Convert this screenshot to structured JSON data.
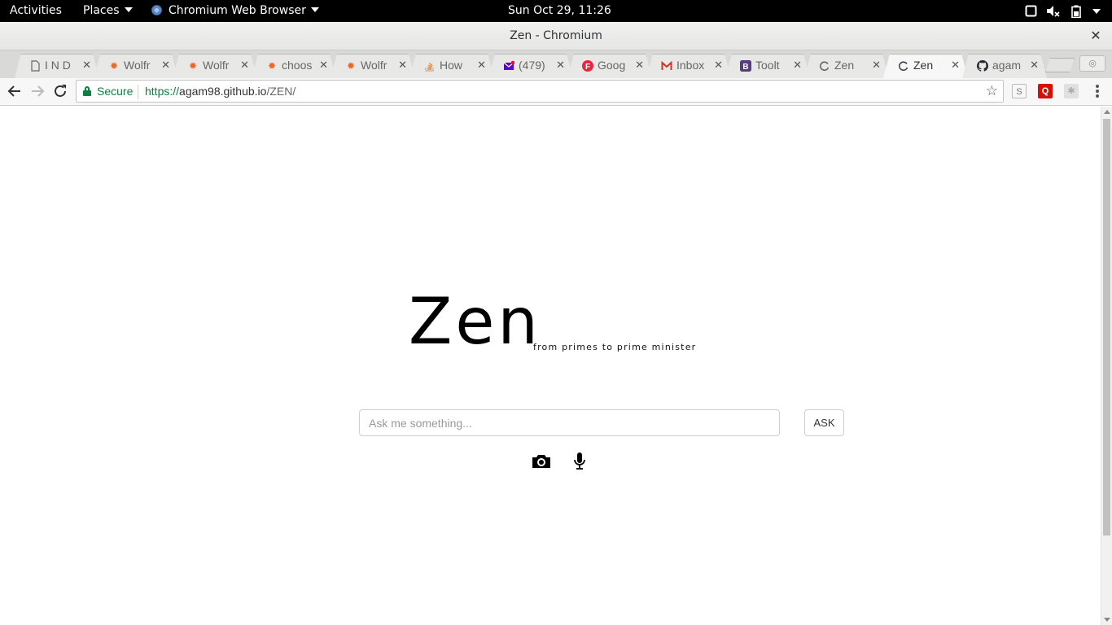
{
  "system_bar": {
    "activities": "Activities",
    "places": "Places",
    "app_menu": "Chromium Web Browser",
    "clock": "Sun Oct 29, 11:26"
  },
  "window": {
    "title": "Zen - Chromium"
  },
  "tabs": [
    {
      "label": "I N D",
      "icon": "page-icon"
    },
    {
      "label": "Wolfr",
      "icon": "wolfram-icon"
    },
    {
      "label": "Wolfr",
      "icon": "wolfram-icon"
    },
    {
      "label": "choos",
      "icon": "wolfram-icon"
    },
    {
      "label": "Wolfr",
      "icon": "wolfram-icon"
    },
    {
      "label": "How",
      "icon": "stackoverflow-icon"
    },
    {
      "label": "(479)",
      "icon": "yahoo-mail-icon"
    },
    {
      "label": "Goog",
      "icon": "f-icon"
    },
    {
      "label": "Inbox",
      "icon": "gmail-icon"
    },
    {
      "label": "Toolt",
      "icon": "bootstrap-icon"
    },
    {
      "label": "Zen",
      "icon": "loading-icon"
    },
    {
      "label": "Zen",
      "icon": "loading-icon",
      "active": true
    },
    {
      "label": "agam",
      "icon": "github-icon"
    }
  ],
  "toolbar": {
    "secure_label": "Secure",
    "url_scheme": "https://",
    "url_host": "agam98.github.io",
    "url_path": "/ZEN/"
  },
  "page": {
    "logo": "Zen",
    "tagline": "from primes to prime minister",
    "search_placeholder": "Ask me something...",
    "ask_label": "ASK",
    "camera_icon": "camera-icon",
    "mic_icon": "microphone-icon"
  },
  "colors": {
    "secure_green": "#0b8043",
    "topbar_bg": "#000000"
  }
}
